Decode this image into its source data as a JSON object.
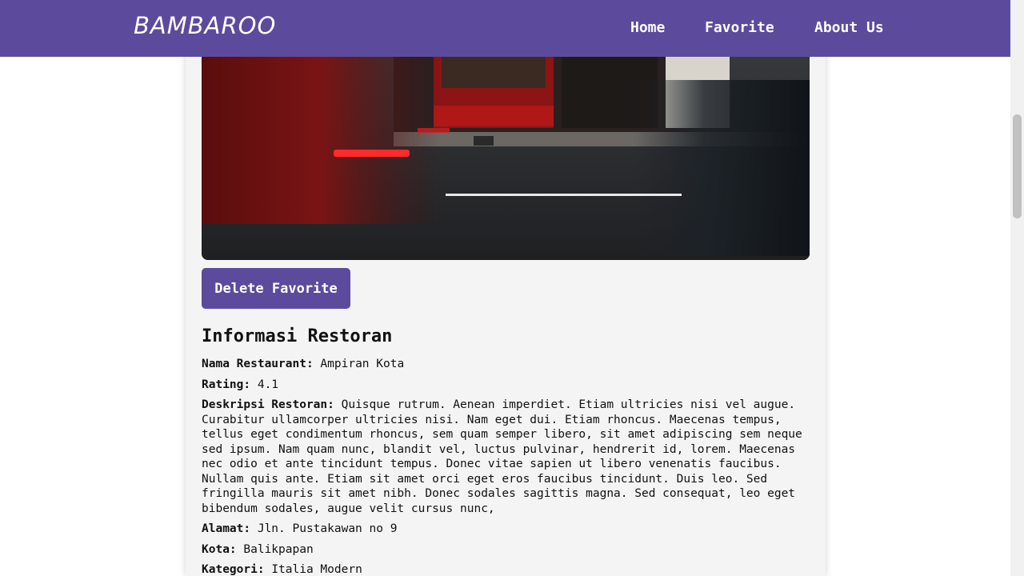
{
  "navbar": {
    "brand": "BAMBAROO",
    "links": [
      {
        "label": "Home"
      },
      {
        "label": "Favorite"
      },
      {
        "label": "About Us"
      }
    ]
  },
  "detail": {
    "delete_button_label": "Delete Favorite",
    "section_title": "Informasi Restoran",
    "fields": {
      "name": {
        "label": "Nama Restaurant:",
        "value": "Ampiran Kota"
      },
      "rating": {
        "label": "Rating:",
        "value": "4.1"
      },
      "desc": {
        "label": "Deskripsi Restoran:",
        "value": "Quisque rutrum. Aenean imperdiet. Etiam ultricies nisi vel augue. Curabitur ullamcorper ultricies nisi. Nam eget dui. Etiam rhoncus. Maecenas tempus, tellus eget condimentum rhoncus, sem quam semper libero, sit amet adipiscing sem neque sed ipsum. Nam quam nunc, blandit vel, luctus pulvinar, hendrerit id, lorem. Maecenas nec odio et ante tincidunt tempus. Donec vitae sapien ut libero venenatis faucibus. Nullam quis ante. Etiam sit amet orci eget eros faucibus tincidunt. Duis leo. Sed fringilla mauris sit amet nibh. Donec sodales sagittis magna. Sed consequat, leo eget bibendum sodales, augue velit cursus nunc,"
      },
      "address": {
        "label": "Alamat:",
        "value": "Jln. Pustakawan no 9"
      },
      "city": {
        "label": "Kota:",
        "value": "Balikpapan"
      },
      "category": {
        "label": "Kategori:",
        "value": "Italia Modern"
      }
    }
  },
  "colors": {
    "brand": "#5c4b9c",
    "card_background": "#f4f4f4"
  }
}
